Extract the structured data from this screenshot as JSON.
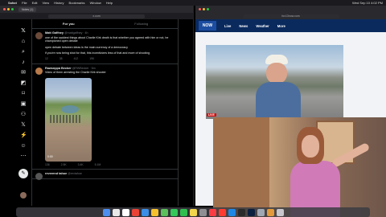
{
  "menubar": {
    "apple": "",
    "app_name": "Safari",
    "items": [
      "File",
      "Edit",
      "View",
      "History",
      "Bookmarks",
      "Window",
      "Help"
    ],
    "status_right": "Wed Sep 10 4:02 PM"
  },
  "x_window": {
    "tab_title": "Notes (1)",
    "url": "x.com",
    "extra_tab": "Live Streams",
    "nav_icons": [
      "x-logo-icon",
      "home-icon",
      "search-icon",
      "bell-icon",
      "mail-icon",
      "grok-icon",
      "bookmark-icon",
      "jobs-icon",
      "communities-icon",
      "premium-icon",
      "verified-orgs-icon",
      "profile-icon",
      "more-icon"
    ],
    "post_button": "✎",
    "feed_tabs": [
      "For you",
      "Following"
    ],
    "posts": [
      {
        "name": "Matt Gaffney",
        "handle": "@mattgaffney · 4h",
        "text": "one of the saddest things about Charlie Kirk death is that whether you agreed with him or not, he championed open debate",
        "text2": "open debate between ideas is the main currency of a democracy",
        "text3": "if you're now being shot for that, this incentivizes less of that and more of shooting",
        "actions": [
          "12",
          "38",
          "412",
          "19K"
        ]
      },
      {
        "name": "Rawsnppa Becker",
        "handle": "@RWBecker · 5m",
        "text": "Video of them arresting the Charlie Kirk shooter",
        "video_time": "0:00",
        "actions": [
          "136",
          "2.5K",
          "3.4K",
          "5.1M"
        ]
      },
      {
        "name": "reverend tahoe",
        "handle": "@revtahoe",
        "text": "",
        "actions": []
      }
    ]
  },
  "news_window": {
    "url": "fox13now.com",
    "logo": "NOW",
    "nav": [
      "Live",
      "News",
      "Weather",
      "More"
    ],
    "live_badge": "LIVE"
  },
  "dock": {
    "apps": [
      "finder",
      "launchpad",
      "calendar",
      "chrome",
      "mail",
      "photos",
      "maps",
      "messages",
      "facetime",
      "notes",
      "settings",
      "music",
      "news",
      "appstore",
      "terminal",
      "photoshop",
      "preview",
      "files",
      "trash"
    ],
    "colors": [
      "#4b8ff0",
      "#e8e8e8",
      "#ffffff",
      "#e94235",
      "#3a8ee6",
      "#f5c22d",
      "#5bbf5a",
      "#34c759",
      "#2fbf4f",
      "#f2d64b",
      "#8e8e93",
      "#fc3c44",
      "#ff3b30",
      "#1e88e5",
      "#2b2b2b",
      "#0b1f3f",
      "#9fa8b3",
      "#e29a3b",
      "#c7c7cc"
    ]
  }
}
